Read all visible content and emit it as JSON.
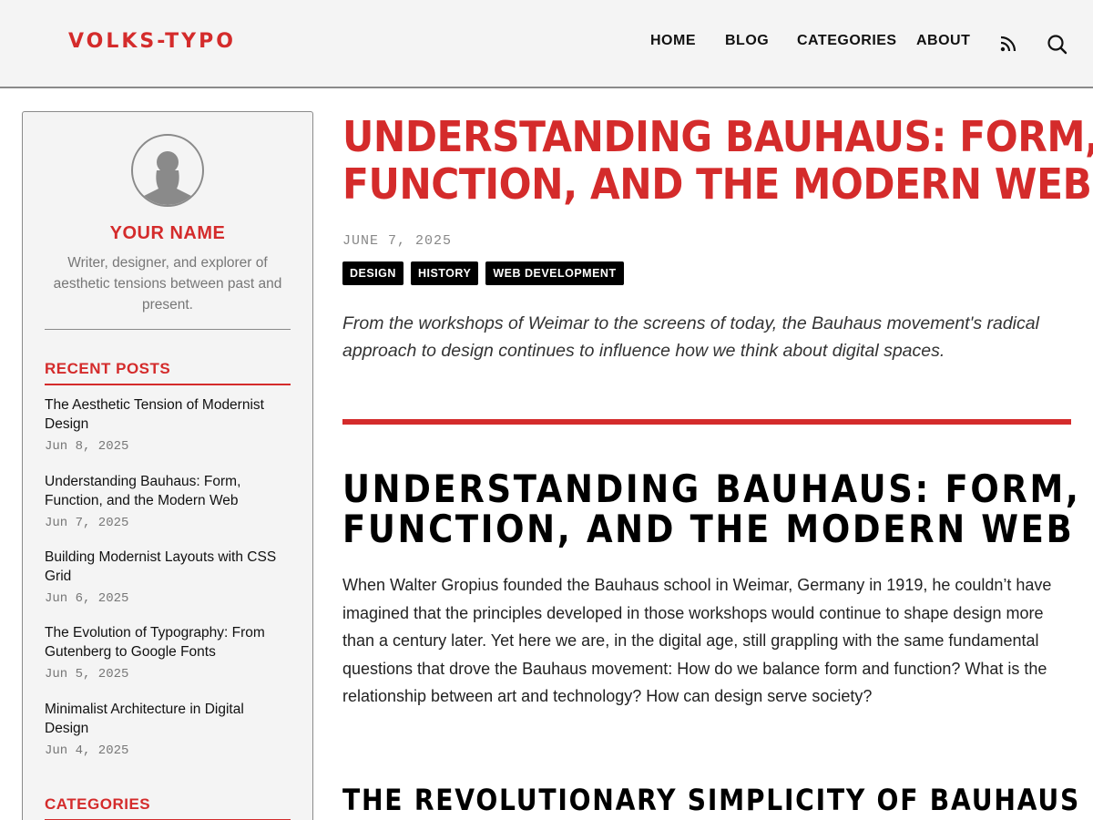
{
  "header": {
    "logo": "VOLKS-TYPO",
    "nav": [
      "HOME",
      "BLOG",
      "CATEGORIES",
      "ABOUT"
    ],
    "icons": [
      "rss-icon",
      "search-icon"
    ]
  },
  "sidebar": {
    "profile": {
      "name": "YOUR NAME",
      "bio": "Writer, designer, and explorer of aesthetic tensions between past and present."
    },
    "recent_heading": "RECENT POSTS",
    "recent_posts": [
      {
        "title": "The Aesthetic Tension of Modernist Design",
        "date": "Jun 8, 2025"
      },
      {
        "title": "Understanding Bauhaus: Form, Function, and the Modern Web",
        "date": "Jun 7, 2025"
      },
      {
        "title": "Building Modernist Layouts with CSS Grid",
        "date": "Jun 6, 2025"
      },
      {
        "title": "The Evolution of Typography: From Gutenberg to Google Fonts",
        "date": "Jun 5, 2025"
      },
      {
        "title": "Minimalist Architecture in Digital Design",
        "date": "Jun 4, 2025"
      }
    ],
    "categories_heading": "CATEGORIES"
  },
  "article": {
    "title_line1": "UNDERSTANDING BAUHAUS: FORM,",
    "title_line2": "FUNCTION, AND THE MODERN WEB",
    "date": "JUNE 7, 2025",
    "tags": [
      "DESIGN",
      "HISTORY",
      "WEB DEVELOPMENT"
    ],
    "lede": "From the workshops of Weimar to the screens of today, the Bauhaus movement's radical approach to design continues to influence how we think about digital spaces.",
    "heading_line1": "UNDERSTANDING BAUHAUS: FORM,",
    "heading_line2": "FUNCTION, AND THE MODERN WEB",
    "paragraph": "When Walter Gropius founded the Bauhaus school in Weimar, Germany in 1919, he couldn’t have imagined that the principles developed in those workshops would continue to shape design more than a century later. Yet here we are, in the digital age, still grappling with the same fundamental questions that drove the Bauhaus movement: How do we balance form and function? What is the relationship between art and technology? How can design serve society?",
    "subheading": "THE REVOLUTIONARY SIMPLICITY OF BAUHAUS"
  },
  "colors": {
    "accent": "#d42b2b",
    "header_bg": "#f4f4f4",
    "tag_bg": "#000000",
    "muted_text": "#777777"
  }
}
